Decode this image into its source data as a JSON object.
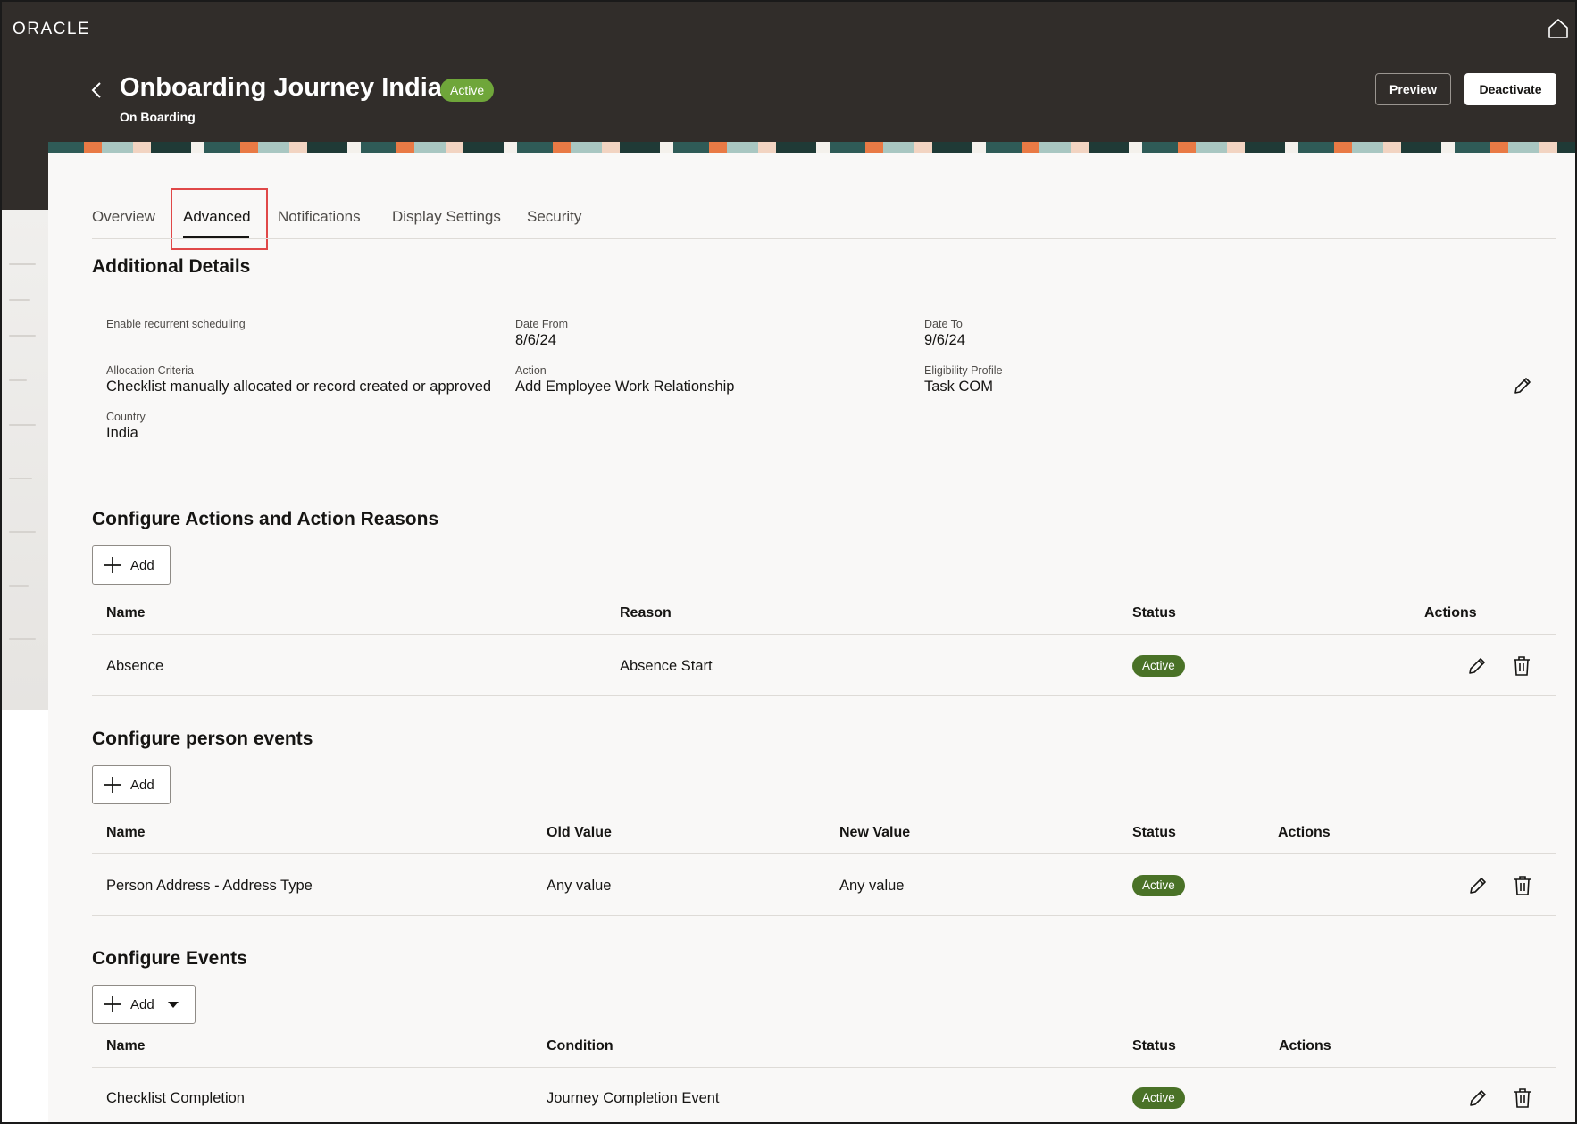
{
  "app": {
    "logo": "ORACLE"
  },
  "header": {
    "title": "Onboarding Journey India",
    "status": "Active",
    "subtitle": "On Boarding",
    "preview_label": "Preview",
    "deactivate_label": "Deactivate"
  },
  "tabs": [
    {
      "label": "Overview"
    },
    {
      "label": "Advanced"
    },
    {
      "label": "Notifications"
    },
    {
      "label": "Display Settings"
    },
    {
      "label": "Security"
    }
  ],
  "active_tab": "Advanced",
  "additional_details": {
    "title": "Additional Details",
    "fields": {
      "recurrent": {
        "label": "Enable recurrent scheduling"
      },
      "date_from": {
        "label": "Date From",
        "value": "8/6/24"
      },
      "date_to": {
        "label": "Date To",
        "value": "9/6/24"
      },
      "allocation": {
        "label": "Allocation Criteria",
        "value": "Checklist manually allocated or record created or approved"
      },
      "action": {
        "label": "Action",
        "value": "Add Employee Work Relationship"
      },
      "eligibility": {
        "label": "Eligibility Profile",
        "value": "Task COM"
      },
      "country": {
        "label": "Country",
        "value": "India"
      }
    }
  },
  "actions_section": {
    "title": "Configure Actions and Action Reasons",
    "add_label": "Add",
    "columns": {
      "name": "Name",
      "reason": "Reason",
      "status": "Status",
      "actions": "Actions"
    },
    "rows": [
      {
        "name": "Absence",
        "reason": "Absence Start",
        "status": "Active"
      }
    ]
  },
  "person_events": {
    "title": "Configure person events",
    "add_label": "Add",
    "columns": {
      "name": "Name",
      "old_value": "Old Value",
      "new_value": "New Value",
      "status": "Status",
      "actions": "Actions"
    },
    "rows": [
      {
        "name": "Person Address - Address Type",
        "old_value": "Any value",
        "new_value": "Any value",
        "status": "Active"
      }
    ]
  },
  "events": {
    "title": "Configure Events",
    "add_label": "Add",
    "columns": {
      "name": "Name",
      "condition": "Condition",
      "status": "Status",
      "actions": "Actions"
    },
    "rows": [
      {
        "name": "Checklist Completion",
        "condition": "Journey Completion Event",
        "status": "Active"
      }
    ]
  },
  "colors": {
    "header_bg": "#312d2a",
    "status_active": "#4a7227",
    "title_badge": "#6fa63a",
    "tab_highlight": "#e04848"
  },
  "icons": {
    "home": "home-icon",
    "back": "chevron-left-icon",
    "edit": "pencil-icon",
    "delete": "trash-icon",
    "add": "plus-icon",
    "dropdown": "caret-down-icon"
  }
}
